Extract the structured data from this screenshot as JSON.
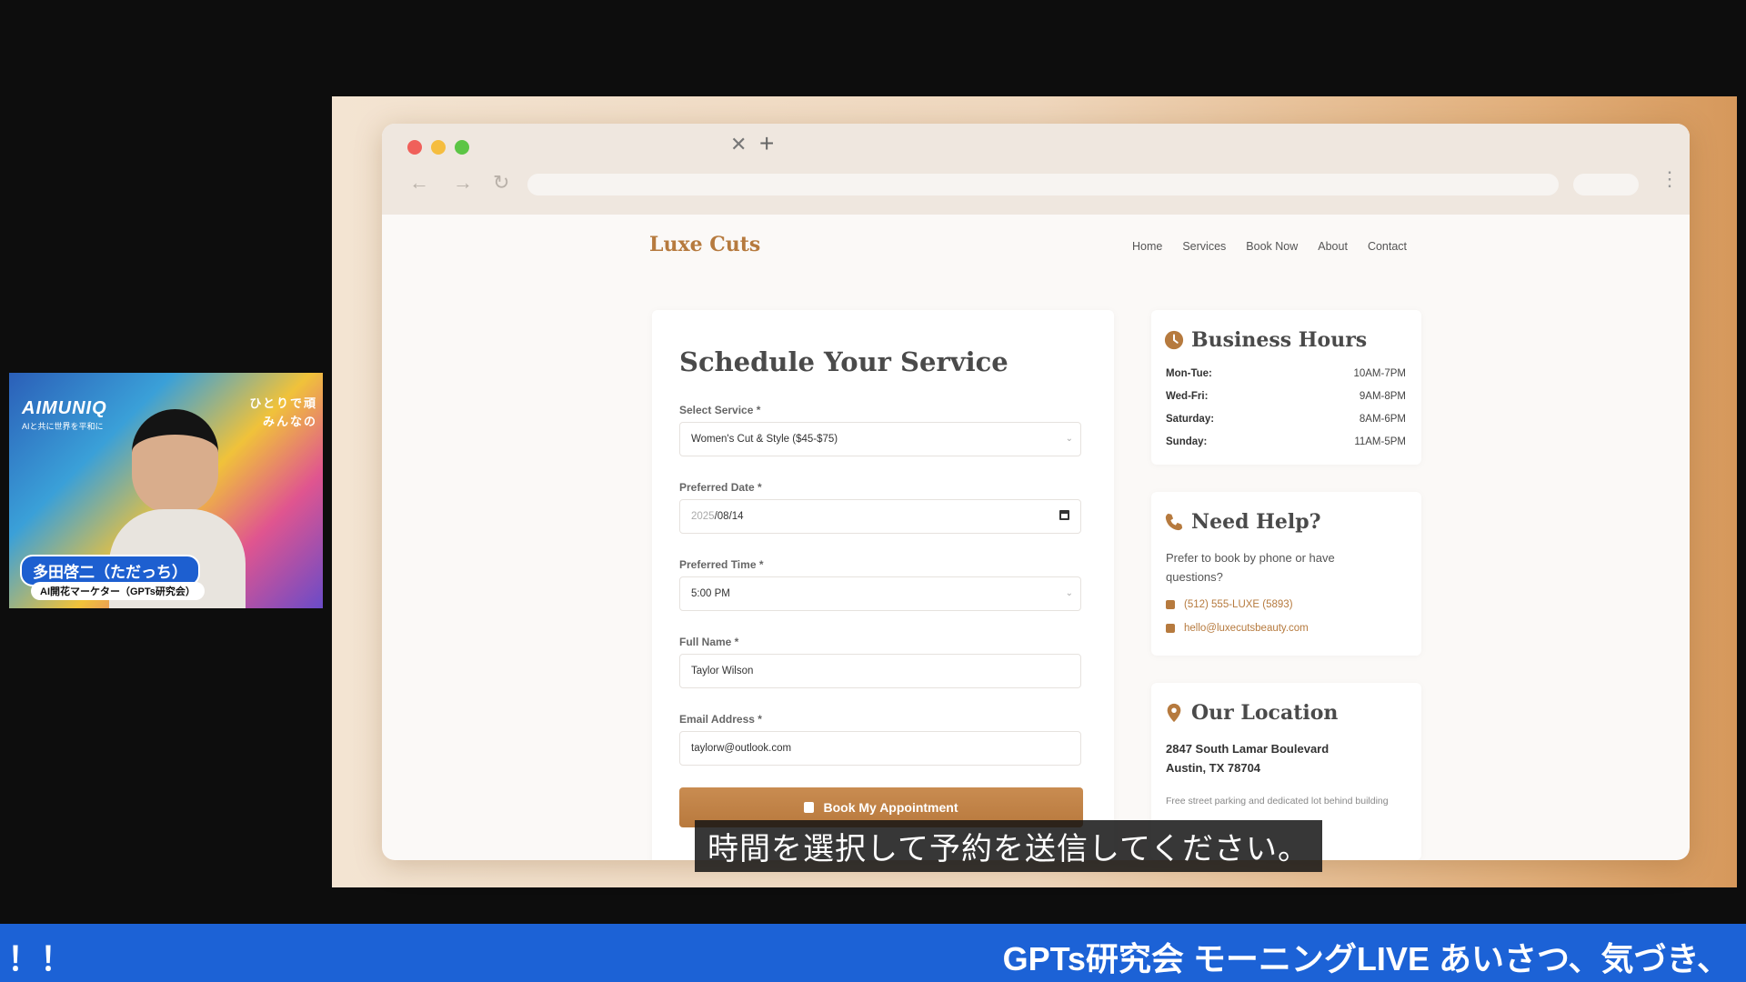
{
  "webcam": {
    "logo": "AIMUNIQ",
    "logo_sub": "AIと共に世界を平和に",
    "tagline_1": "ひとりで頑",
    "tagline_2": "みんなの",
    "name": "多田啓二（ただっち）",
    "role": "AI開花マーケター（GPTs研究会）"
  },
  "site": {
    "brand": "Luxe Cuts",
    "nav": [
      "Home",
      "Services",
      "Book Now",
      "About",
      "Contact"
    ]
  },
  "form": {
    "title": "Schedule Your Service",
    "service_label": "Select Service *",
    "service_value": "Women's Cut & Style ($45-$75)",
    "date_label": "Preferred Date *",
    "date_year": "2025",
    "date_rest": "/08/14",
    "time_label": "Preferred Time *",
    "time_value": "5:00 PM",
    "name_label": "Full Name *",
    "name_value": "Taylor Wilson",
    "email_label": "Email Address *",
    "email_value": "taylorw@outlook.com",
    "submit_label": "Book My Appointment"
  },
  "hours": {
    "title": "Business Hours",
    "rows": [
      {
        "day": "Mon-Tue:",
        "time": "10AM-7PM"
      },
      {
        "day": "Wed-Fri:",
        "time": "9AM-8PM"
      },
      {
        "day": "Saturday:",
        "time": "8AM-6PM"
      },
      {
        "day": "Sunday:",
        "time": "11AM-5PM"
      }
    ]
  },
  "help": {
    "title": "Need Help?",
    "text": "Prefer to book by phone or have questions?",
    "phone": "(512) 555-LUXE (5893)",
    "email": "hello@luxecutsbeauty.com"
  },
  "location": {
    "title": "Our Location",
    "street": "2847 South Lamar Boulevard",
    "city": "Austin, TX 78704",
    "note": "Free street parking and dedicated lot behind building"
  },
  "subtitle": "時間を選択して予約を送信してください。",
  "ticker": {
    "left": "！！",
    "right": "GPTs研究会 モーニングLIVE あいさつ、気づき、"
  },
  "colors": {
    "accent": "#b67a3e",
    "ticker_bg": "#1c62d6"
  }
}
